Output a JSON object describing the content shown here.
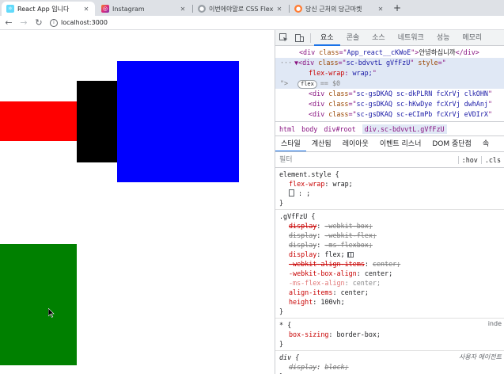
{
  "tabs": [
    {
      "title": "React App 입니다",
      "favicon": "react-icon",
      "active": true
    },
    {
      "title": "Instagram",
      "favicon": "instagram-icon",
      "active": false
    },
    {
      "title": "이번에야말로 CSS Flex를 익혀보자",
      "favicon": "github-icon",
      "active": false
    },
    {
      "title": "당신 근처의 당근마켓",
      "favicon": "carrot-icon",
      "active": false
    }
  ],
  "new_tab_label": "+",
  "toolbar": {
    "url": "localhost:3000"
  },
  "page": {
    "boxes": [
      {
        "name": "red",
        "color": "#ff0000"
      },
      {
        "name": "black",
        "color": "#000000"
      },
      {
        "name": "blue",
        "color": "#0000ff"
      },
      {
        "name": "green",
        "color": "#008000"
      }
    ]
  },
  "devtools": {
    "tabs": [
      "요소",
      "콘솔",
      "소스",
      "네트워크",
      "성능",
      "메모리"
    ],
    "active_tab": "요소",
    "tree": {
      "row1": {
        "tag": "div",
        "attr": "class",
        "val": "App_react__cKWoE",
        "text": "안녕하십니까"
      },
      "row2": {
        "tag": "div",
        "attr": "class",
        "val": "sc-bdvvtL gVfFzU",
        "attr2": "style"
      },
      "row3": {
        "prop": "flex-wrap",
        "value": "wrap;"
      },
      "row4": {
        "badge": "flex",
        "ref": "== $0"
      },
      "row5": {
        "val": "sc-gsDKAQ sc-dkPLRN fcXrVj clkOHN"
      },
      "row6": {
        "val": "sc-gsDKAQ sc-hKwDye fcXrVj dwhAnj"
      },
      "row7": {
        "val": "sc-gsDKAQ sc-eCImPb fcXrVj eVDIrX"
      }
    },
    "breadcrumbs": [
      "html",
      "body",
      "div#root",
      "div.sc-bdvvtL.gVfFzU"
    ],
    "styles_tabs": [
      "스타일",
      "계산됨",
      "레이아웃",
      "이벤트 리스너",
      "DOM 중단점",
      "속"
    ],
    "filter": {
      "placeholder": "필터",
      "hov": ":hov",
      "cls": ".cls"
    },
    "rules": {
      "element_style": {
        "selector": "element.style {",
        "d1": {
          "p": "flex-wrap",
          "v": "wrap;"
        },
        "close": "}"
      },
      "gvf": {
        "selector": ".gVfFzU {",
        "d1": {
          "p": "display",
          "v": "-webkit-box;"
        },
        "d2": {
          "p": "display",
          "v": "-webkit-flex;"
        },
        "d3": {
          "p": "display",
          "v": "-ms-flexbox;"
        },
        "d4": {
          "p": "display",
          "v": "flex;"
        },
        "d5": {
          "p": "-webkit-align-items",
          "v": "center;"
        },
        "d6": {
          "p": "-webkit-box-align",
          "v": "center;"
        },
        "d7": {
          "p": "-ms-flex-align",
          "v": "center;"
        },
        "d8": {
          "p": "align-items",
          "v": "center;"
        },
        "d9": {
          "p": "height",
          "v": "100vh;"
        },
        "close": "}"
      },
      "universal": {
        "selector": "* {",
        "origin": "inde",
        "d1": {
          "p": "box-sizing",
          "v": "border-box;"
        },
        "close": "}"
      },
      "div": {
        "selector": "div {",
        "origin": "사용자 에이전트",
        "d1": {
          "p": "display",
          "v": "block;"
        },
        "close": "}"
      }
    }
  }
}
